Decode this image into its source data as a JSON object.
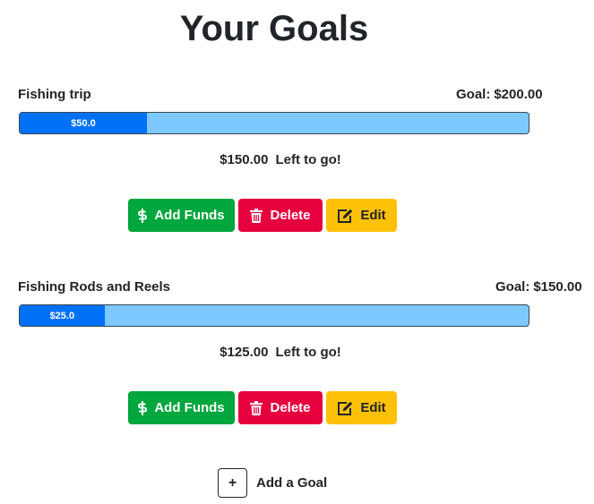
{
  "page_title": "Your Goals",
  "goals": [
    {
      "name": "Fishing trip",
      "target_label": "Goal:",
      "target_amount": "$200.00",
      "progress_text": "$50.0",
      "progress_fraction": 0.25,
      "remaining_amount": "$150.00",
      "remaining_label": "Left to go!",
      "actions": {
        "add_funds": "Add Funds",
        "delete": "Delete",
        "edit": "Edit"
      }
    },
    {
      "name": "Fishing Rods and Reels",
      "target_label": "Goal:",
      "target_amount": "$150.00",
      "progress_text": "$25.0",
      "progress_fraction": 0.1667,
      "remaining_amount": "$125.00",
      "remaining_label": "Left to go!",
      "actions": {
        "add_funds": "Add Funds",
        "delete": "Delete",
        "edit": "Edit"
      }
    }
  ],
  "add_goal": {
    "icon_text": "+",
    "label": "Add a Goal"
  },
  "colors": {
    "add_funds": "#00a63e",
    "delete": "#e6003e",
    "edit": "#ffc107",
    "progress_fill": "#0071f5",
    "progress_track": "#7dc8ff"
  },
  "icons": {
    "add_funds": "dollar-icon",
    "delete": "trash-icon",
    "edit": "edit-icon"
  }
}
